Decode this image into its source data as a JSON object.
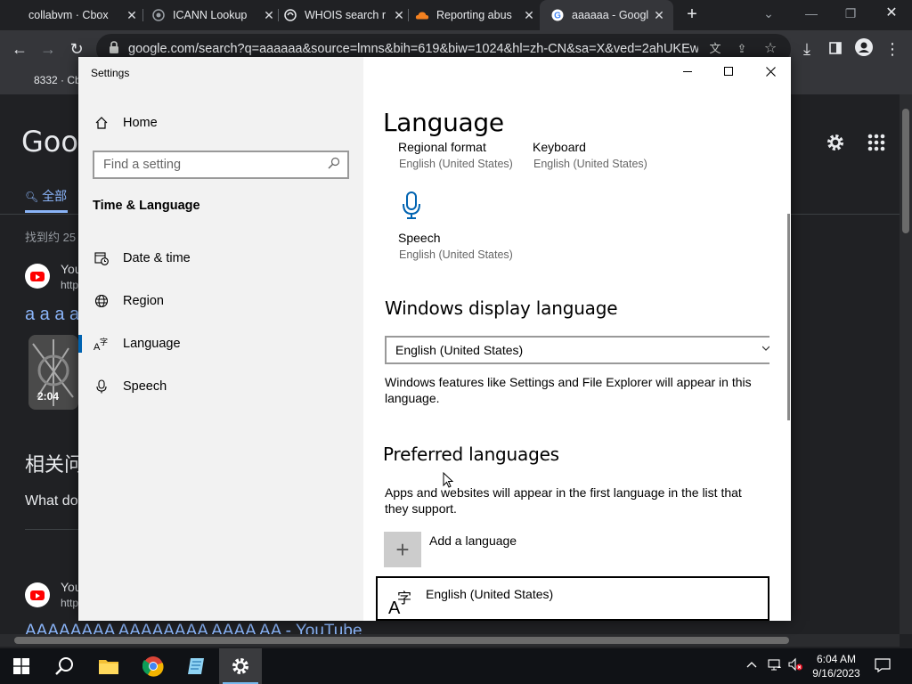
{
  "browser": {
    "tabs": [
      {
        "title": "collabvm · Cbox",
        "active": false
      },
      {
        "title": "ICANN Lookup",
        "active": false
      },
      {
        "title": "WHOIS search r",
        "active": false
      },
      {
        "title": "Reporting abus",
        "active": false
      },
      {
        "title": "aaaaaa - Googl",
        "active": true
      }
    ],
    "url": "google.com/search?q=aaaaaa&source=lmns&bih=619&biw=1024&hl=zh-CN&sa=X&ved=2ahUKEwj...",
    "bookmark": "8332 · Cb"
  },
  "google": {
    "logo": "Goog",
    "tab_all": "全部",
    "result_count": "找到约 25",
    "r1_site": "You",
    "r1_url": "http",
    "r1_title": "a a a a",
    "video_duration": "2:04",
    "related_heading": "相关问",
    "related_q": "What do",
    "r2_site": "You",
    "r2_url": "http",
    "r2_title": "AAAAAAAA AAAAAAAA AAAA AA - YouTube"
  },
  "settings": {
    "window_title": "Settings",
    "sidebar": {
      "home": "Home",
      "search_placeholder": "Find a setting",
      "section": "Time & Language",
      "items": [
        {
          "label": "Date & time",
          "icon": "calendar-clock-icon"
        },
        {
          "label": "Region",
          "icon": "globe-icon"
        },
        {
          "label": "Language",
          "icon": "language-icon",
          "selected": true
        },
        {
          "label": "Speech",
          "icon": "microphone-icon"
        }
      ]
    },
    "content": {
      "title": "Language",
      "regional_format_label": "Regional format",
      "regional_format_value": "English (United States)",
      "keyboard_label": "Keyboard",
      "keyboard_value": "English (United States)",
      "speech_label": "Speech",
      "speech_value": "English (United States)",
      "display_heading": "Windows display language",
      "display_value": "English (United States)",
      "display_desc": "Windows features like Settings and File Explorer will appear in this language.",
      "preferred_heading": "Preferred languages",
      "preferred_desc": "Apps and websites will appear in the first language in the list that they support.",
      "add_language": "Add a language",
      "lang_item": "English (United States)"
    }
  },
  "taskbar": {
    "time": "6:04 AM",
    "date": "9/16/2023"
  },
  "colors": {
    "accent": "#0063b1",
    "chrome_dark": "#202124",
    "link": "#8ab4f8"
  }
}
